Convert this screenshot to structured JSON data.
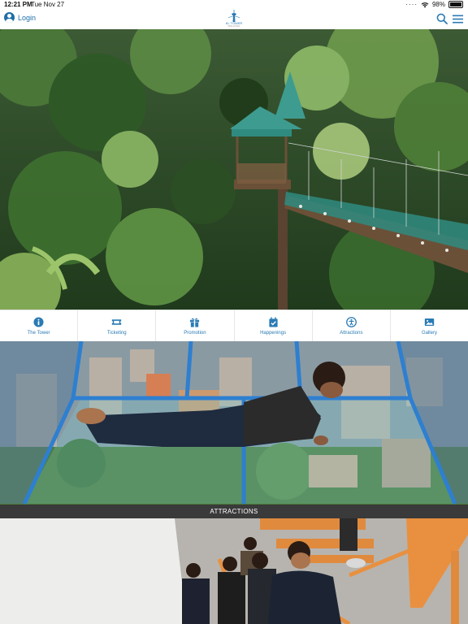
{
  "status_bar": {
    "time": "12:21 PM",
    "date": "Tue Nov 27",
    "battery": "98%",
    "battery_level": 0.98
  },
  "header": {
    "login_label": "Login",
    "logo_text": "KL TOWER",
    "logo_subtext": "MALAYSIA"
  },
  "menu": {
    "items": [
      {
        "label": "The Tower",
        "icon": "info-icon"
      },
      {
        "label": "Ticketing",
        "icon": "ticket-icon"
      },
      {
        "label": "Promotion",
        "icon": "gift-icon"
      },
      {
        "label": "Happenings",
        "icon": "calendar-check-icon"
      },
      {
        "label": "Attractions",
        "icon": "accessibility-icon"
      },
      {
        "label": "Gallery",
        "icon": "image-icon"
      }
    ]
  },
  "sections": {
    "attractions_title": "ATTRACTIONS"
  },
  "colors": {
    "accent": "#2a7bb5",
    "bar": "#3a3a3a"
  }
}
